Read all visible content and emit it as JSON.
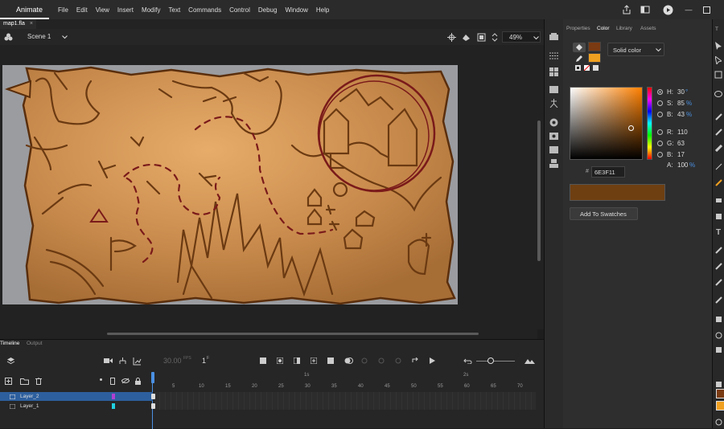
{
  "app": {
    "name": "Animate"
  },
  "menu": [
    "File",
    "Edit",
    "View",
    "Insert",
    "Modify",
    "Text",
    "Commands",
    "Control",
    "Debug",
    "Window",
    "Help"
  ],
  "document": {
    "tab_label": "map1.fla",
    "tab_close": "×",
    "scene": "Scene 1",
    "zoom": "49%"
  },
  "panel": {
    "tabs": [
      "Properties",
      "Color",
      "Library",
      "Assets"
    ],
    "active_tab": "Color",
    "fill_type": "Solid color",
    "stroke_color": "#7a3a12",
    "fill_color": "#f0a020",
    "hsb": [
      {
        "label": "H:",
        "value": "30",
        "unit": "°"
      },
      {
        "label": "S:",
        "value": "85",
        "unit": "%"
      },
      {
        "label": "B:",
        "value": "43",
        "unit": "%"
      }
    ],
    "rgb": [
      {
        "label": "R:",
        "value": "110"
      },
      {
        "label": "G:",
        "value": "63"
      },
      {
        "label": "B:",
        "value": "17"
      }
    ],
    "alpha": {
      "label": "A:",
      "value": "100",
      "unit": "%"
    },
    "hex_label": "#",
    "hex": "6E3F11",
    "current_color": "#6e3f11",
    "add_swatches": "Add To Swatches"
  },
  "timeline": {
    "tabs": [
      "Timeline",
      "Output"
    ],
    "fps": "30.00",
    "fps_unit": "FPS",
    "frame": "1",
    "frame_unit": "F",
    "seconds": [
      "1s",
      "2s"
    ],
    "frame_ticks": [
      "5",
      "10",
      "15",
      "20",
      "25",
      "30",
      "35",
      "40",
      "45",
      "50",
      "55",
      "60",
      "65",
      "70"
    ],
    "layers": [
      {
        "name": "Layer_2",
        "selected": true,
        "color": "#b040d0"
      },
      {
        "name": "Layer_1",
        "selected": false,
        "color": "#20d0e0"
      }
    ]
  }
}
